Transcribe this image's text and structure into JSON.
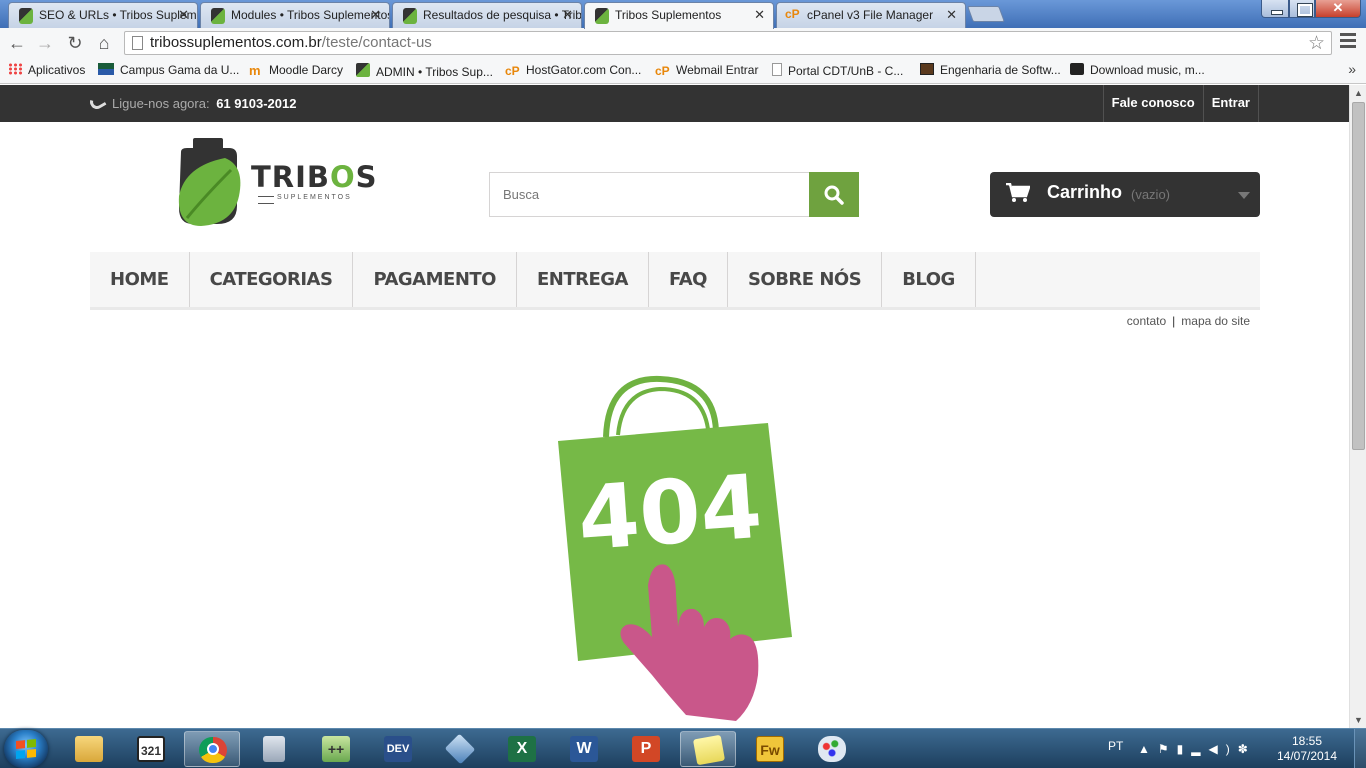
{
  "browser": {
    "tabs": [
      {
        "title": "SEO & URLs • Tribos Suplementos",
        "icon": "tribos-favicon"
      },
      {
        "title": "Modules • Tribos Suplementos",
        "icon": "tribos-favicon"
      },
      {
        "title": "Resultados de pesquisa • Tribos",
        "icon": "tribos-favicon"
      },
      {
        "title": "Tribos Suplementos",
        "icon": "tribos-favicon",
        "active": true
      },
      {
        "title": "cPanel v3 File Manager",
        "icon": "cpanel-favicon"
      }
    ],
    "url_host": "tribossuplementos.com.br",
    "url_path": "/teste/contact-us",
    "bookmarks": [
      {
        "label": "Aplicativos",
        "icon": "apps-grid-icon"
      },
      {
        "label": "Campus Gama da U...",
        "icon": "flag-icon"
      },
      {
        "label": "Moodle Darcy",
        "icon": "moodle-icon"
      },
      {
        "label": "ADMIN • Tribos Sup...",
        "icon": "tribos-favicon"
      },
      {
        "label": "HostGator.com Con...",
        "icon": "cpanel-icon"
      },
      {
        "label": "Webmail Entrar",
        "icon": "cpanel-icon"
      },
      {
        "label": "Portal CDT/UnB - C...",
        "icon": "page-icon"
      },
      {
        "label": "Engenharia de Softw...",
        "icon": "book-icon"
      },
      {
        "label": "Download music, m...",
        "icon": "download-icon"
      }
    ]
  },
  "site": {
    "phone_label": "Ligue-nos agora:",
    "phone_number": "61 9103-2012",
    "top_links": [
      "Fale conosco",
      "Entrar"
    ],
    "logo_main_a": "TRIB",
    "logo_main_o": "O",
    "logo_main_b": "S",
    "logo_sub": "SUPLEMENTOS",
    "search_placeholder": "Busca",
    "cart_label": "Carrinho",
    "cart_status": "(vazio)",
    "menu": [
      "HOME",
      "CATEGORIAS",
      "PAGAMENTO",
      "ENTREGA",
      "FAQ",
      "SOBRE NÓS",
      "BLOG"
    ],
    "crumb_links": [
      "contato",
      "mapa do site"
    ],
    "error_code": "404"
  },
  "taskbar": {
    "apps": [
      "explorer",
      "media-player-classic",
      "chrome",
      "calculator",
      "notepad-plus",
      "dev-cpp",
      "virtualbox",
      "excel",
      "word",
      "powerpoint",
      "sticky-notes",
      "fireworks",
      "paint"
    ],
    "apps_labels": {
      "dev": "DEV",
      "excel": "X",
      "word": "W",
      "powerpoint": "P",
      "fireworks": "Fw"
    },
    "language": "PT",
    "time": "18:55",
    "date": "14/07/2014"
  },
  "colors": {
    "brand_green": "#6fa23f",
    "error_pink": "#c9578a",
    "dark": "#333333"
  }
}
